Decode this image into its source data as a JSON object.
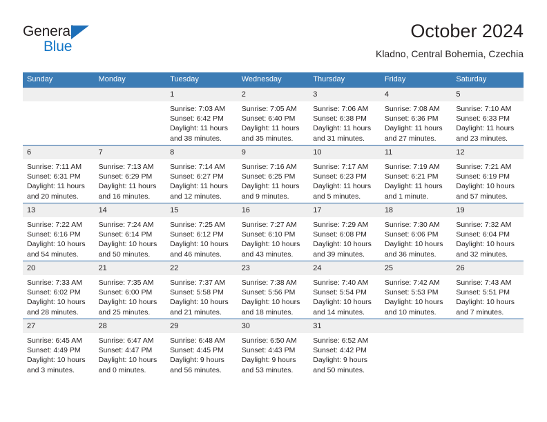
{
  "brand": {
    "name_top": "General",
    "name_bottom": "Blue",
    "color_dark": "#231f20",
    "color_blue": "#1477c7"
  },
  "header": {
    "title": "October 2024",
    "subtitle": "Kladno, Central Bohemia, Czechia"
  },
  "theme": {
    "header_bg": "#3c7cb5",
    "header_text": "#ffffff",
    "daynum_bg": "#efefef",
    "row_rule": "#1f5fa0",
    "body_bg": "#ffffff"
  },
  "weekday_headers": [
    "Sunday",
    "Monday",
    "Tuesday",
    "Wednesday",
    "Thursday",
    "Friday",
    "Saturday"
  ],
  "weeks": [
    [
      {
        "day": "",
        "lines": []
      },
      {
        "day": "",
        "lines": []
      },
      {
        "day": "1",
        "lines": [
          "Sunrise: 7:03 AM",
          "Sunset: 6:42 PM",
          "Daylight: 11 hours",
          "and 38 minutes."
        ]
      },
      {
        "day": "2",
        "lines": [
          "Sunrise: 7:05 AM",
          "Sunset: 6:40 PM",
          "Daylight: 11 hours",
          "and 35 minutes."
        ]
      },
      {
        "day": "3",
        "lines": [
          "Sunrise: 7:06 AM",
          "Sunset: 6:38 PM",
          "Daylight: 11 hours",
          "and 31 minutes."
        ]
      },
      {
        "day": "4",
        "lines": [
          "Sunrise: 7:08 AM",
          "Sunset: 6:36 PM",
          "Daylight: 11 hours",
          "and 27 minutes."
        ]
      },
      {
        "day": "5",
        "lines": [
          "Sunrise: 7:10 AM",
          "Sunset: 6:33 PM",
          "Daylight: 11 hours",
          "and 23 minutes."
        ]
      }
    ],
    [
      {
        "day": "6",
        "lines": [
          "Sunrise: 7:11 AM",
          "Sunset: 6:31 PM",
          "Daylight: 11 hours",
          "and 20 minutes."
        ]
      },
      {
        "day": "7",
        "lines": [
          "Sunrise: 7:13 AM",
          "Sunset: 6:29 PM",
          "Daylight: 11 hours",
          "and 16 minutes."
        ]
      },
      {
        "day": "8",
        "lines": [
          "Sunrise: 7:14 AM",
          "Sunset: 6:27 PM",
          "Daylight: 11 hours",
          "and 12 minutes."
        ]
      },
      {
        "day": "9",
        "lines": [
          "Sunrise: 7:16 AM",
          "Sunset: 6:25 PM",
          "Daylight: 11 hours",
          "and 9 minutes."
        ]
      },
      {
        "day": "10",
        "lines": [
          "Sunrise: 7:17 AM",
          "Sunset: 6:23 PM",
          "Daylight: 11 hours",
          "and 5 minutes."
        ]
      },
      {
        "day": "11",
        "lines": [
          "Sunrise: 7:19 AM",
          "Sunset: 6:21 PM",
          "Daylight: 11 hours",
          "and 1 minute."
        ]
      },
      {
        "day": "12",
        "lines": [
          "Sunrise: 7:21 AM",
          "Sunset: 6:19 PM",
          "Daylight: 10 hours",
          "and 57 minutes."
        ]
      }
    ],
    [
      {
        "day": "13",
        "lines": [
          "Sunrise: 7:22 AM",
          "Sunset: 6:16 PM",
          "Daylight: 10 hours",
          "and 54 minutes."
        ]
      },
      {
        "day": "14",
        "lines": [
          "Sunrise: 7:24 AM",
          "Sunset: 6:14 PM",
          "Daylight: 10 hours",
          "and 50 minutes."
        ]
      },
      {
        "day": "15",
        "lines": [
          "Sunrise: 7:25 AM",
          "Sunset: 6:12 PM",
          "Daylight: 10 hours",
          "and 46 minutes."
        ]
      },
      {
        "day": "16",
        "lines": [
          "Sunrise: 7:27 AM",
          "Sunset: 6:10 PM",
          "Daylight: 10 hours",
          "and 43 minutes."
        ]
      },
      {
        "day": "17",
        "lines": [
          "Sunrise: 7:29 AM",
          "Sunset: 6:08 PM",
          "Daylight: 10 hours",
          "and 39 minutes."
        ]
      },
      {
        "day": "18",
        "lines": [
          "Sunrise: 7:30 AM",
          "Sunset: 6:06 PM",
          "Daylight: 10 hours",
          "and 36 minutes."
        ]
      },
      {
        "day": "19",
        "lines": [
          "Sunrise: 7:32 AM",
          "Sunset: 6:04 PM",
          "Daylight: 10 hours",
          "and 32 minutes."
        ]
      }
    ],
    [
      {
        "day": "20",
        "lines": [
          "Sunrise: 7:33 AM",
          "Sunset: 6:02 PM",
          "Daylight: 10 hours",
          "and 28 minutes."
        ]
      },
      {
        "day": "21",
        "lines": [
          "Sunrise: 7:35 AM",
          "Sunset: 6:00 PM",
          "Daylight: 10 hours",
          "and 25 minutes."
        ]
      },
      {
        "day": "22",
        "lines": [
          "Sunrise: 7:37 AM",
          "Sunset: 5:58 PM",
          "Daylight: 10 hours",
          "and 21 minutes."
        ]
      },
      {
        "day": "23",
        "lines": [
          "Sunrise: 7:38 AM",
          "Sunset: 5:56 PM",
          "Daylight: 10 hours",
          "and 18 minutes."
        ]
      },
      {
        "day": "24",
        "lines": [
          "Sunrise: 7:40 AM",
          "Sunset: 5:54 PM",
          "Daylight: 10 hours",
          "and 14 minutes."
        ]
      },
      {
        "day": "25",
        "lines": [
          "Sunrise: 7:42 AM",
          "Sunset: 5:53 PM",
          "Daylight: 10 hours",
          "and 10 minutes."
        ]
      },
      {
        "day": "26",
        "lines": [
          "Sunrise: 7:43 AM",
          "Sunset: 5:51 PM",
          "Daylight: 10 hours",
          "and 7 minutes."
        ]
      }
    ],
    [
      {
        "day": "27",
        "lines": [
          "Sunrise: 6:45 AM",
          "Sunset: 4:49 PM",
          "Daylight: 10 hours",
          "and 3 minutes."
        ]
      },
      {
        "day": "28",
        "lines": [
          "Sunrise: 6:47 AM",
          "Sunset: 4:47 PM",
          "Daylight: 10 hours",
          "and 0 minutes."
        ]
      },
      {
        "day": "29",
        "lines": [
          "Sunrise: 6:48 AM",
          "Sunset: 4:45 PM",
          "Daylight: 9 hours",
          "and 56 minutes."
        ]
      },
      {
        "day": "30",
        "lines": [
          "Sunrise: 6:50 AM",
          "Sunset: 4:43 PM",
          "Daylight: 9 hours",
          "and 53 minutes."
        ]
      },
      {
        "day": "31",
        "lines": [
          "Sunrise: 6:52 AM",
          "Sunset: 4:42 PM",
          "Daylight: 9 hours",
          "and 50 minutes."
        ]
      },
      {
        "day": "",
        "lines": []
      },
      {
        "day": "",
        "lines": []
      }
    ]
  ]
}
